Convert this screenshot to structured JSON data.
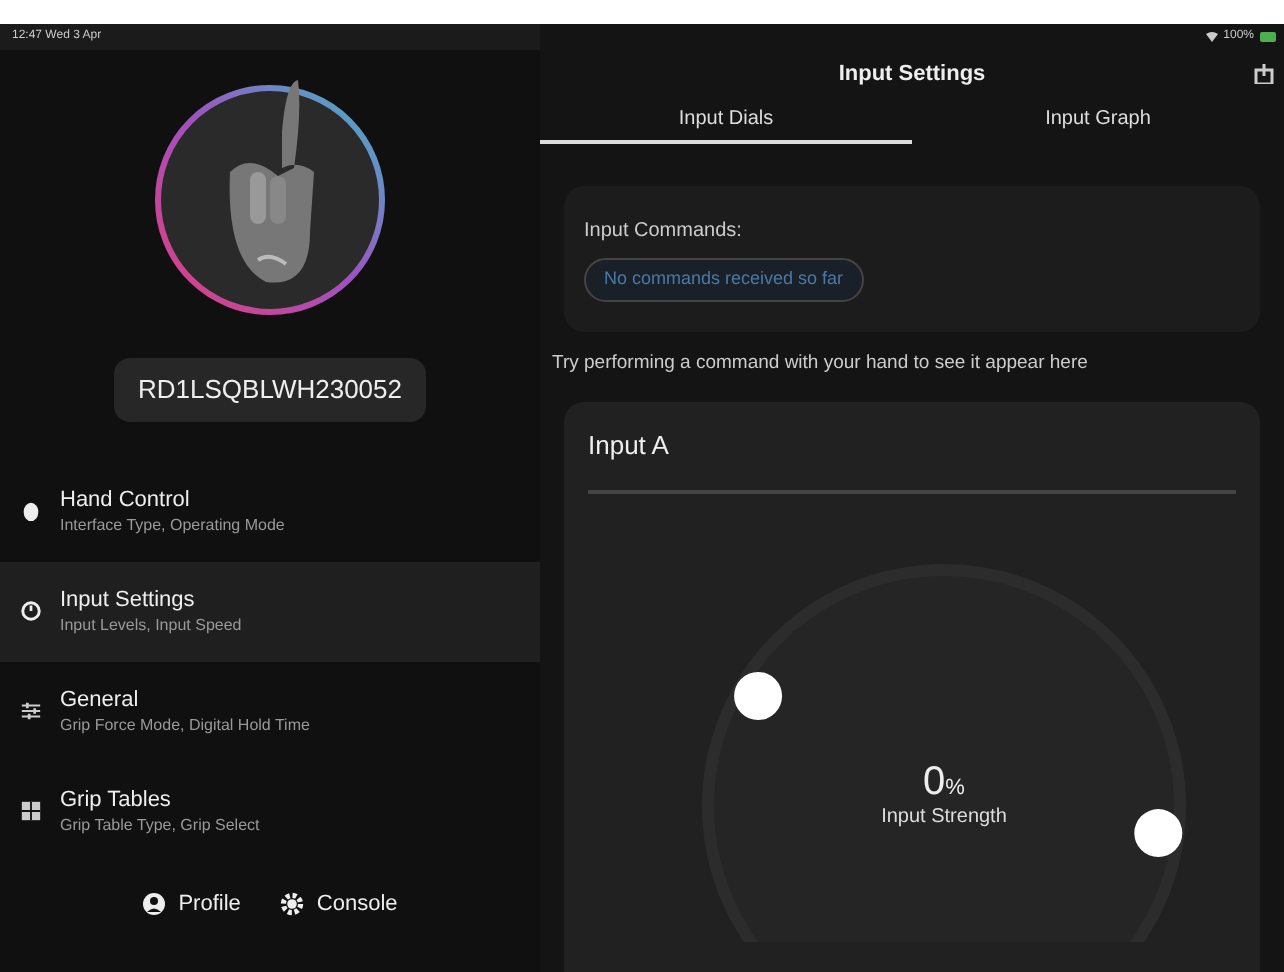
{
  "status_bar": {
    "time": "12:47  Wed 3 Apr",
    "battery": "100%"
  },
  "device": {
    "serial": "RD1LSQBLWH230052"
  },
  "sidebar": {
    "items": [
      {
        "title": "Hand Control",
        "subtitle": "Interface Type, Operating Mode",
        "selected": false
      },
      {
        "title": "Input Settings",
        "subtitle": "Input Levels, Input Speed",
        "selected": true
      },
      {
        "title": "General",
        "subtitle": "Grip Force Mode, Digital Hold Time",
        "selected": false
      },
      {
        "title": "Grip Tables",
        "subtitle": "Grip Table Type, Grip Select",
        "selected": false
      }
    ],
    "footer": [
      {
        "label": "Profile"
      },
      {
        "label": "Console"
      }
    ]
  },
  "header": {
    "title": "Input Settings"
  },
  "tabs": [
    {
      "label": "Input Dials",
      "selected": true
    },
    {
      "label": "Input Graph",
      "selected": false
    }
  ],
  "commands": {
    "label": "Input Commands:",
    "value": "No commands received so far",
    "hint": "Try performing a command with your hand to see it appear here"
  },
  "input_card": {
    "title": "Input A",
    "value": "0",
    "unit": "%",
    "caption": "Input Strength",
    "thumbs": [
      {
        "level": 0.28
      },
      {
        "level": 0.86
      }
    ]
  }
}
